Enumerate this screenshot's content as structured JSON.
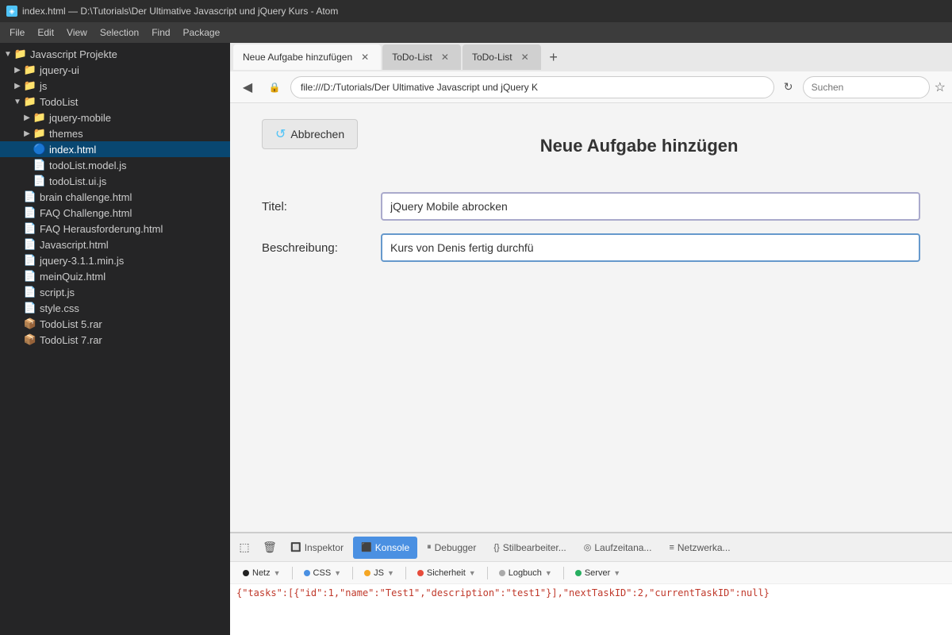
{
  "titlebar": {
    "icon": "◈",
    "text": "index.html — D:\\Tutorials\\Der Ultimative Javascript und jQuery Kurs - Atom"
  },
  "menubar": {
    "items": [
      "File",
      "Edit",
      "View",
      "Selection",
      "Find",
      "Package"
    ]
  },
  "sidebar": {
    "root_label": "Javascript Projekte",
    "items": [
      {
        "label": "jquery-ui",
        "type": "folder",
        "indent": 1,
        "open": false
      },
      {
        "label": "js",
        "type": "folder",
        "indent": 1,
        "open": false
      },
      {
        "label": "TodoList",
        "type": "folder",
        "indent": 1,
        "open": true
      },
      {
        "label": "jquery-mobile",
        "type": "folder",
        "indent": 2,
        "open": false
      },
      {
        "label": "themes",
        "type": "folder",
        "indent": 2,
        "open": false
      },
      {
        "label": "index.html",
        "type": "file",
        "indent": 2,
        "active": true
      },
      {
        "label": "todoList.model.js",
        "type": "file",
        "indent": 2
      },
      {
        "label": "todoList.ui.js",
        "type": "file",
        "indent": 2
      },
      {
        "label": "brain challenge.html",
        "type": "file",
        "indent": 1
      },
      {
        "label": "FAQ Challenge.html",
        "type": "file",
        "indent": 1
      },
      {
        "label": "FAQ Herausforderung.html",
        "type": "file",
        "indent": 1
      },
      {
        "label": "Javascript.html",
        "type": "file",
        "indent": 1
      },
      {
        "label": "jquery-3.1.1.min.js",
        "type": "file",
        "indent": 1
      },
      {
        "label": "meinQuiz.html",
        "type": "file",
        "indent": 1
      },
      {
        "label": "script.js",
        "type": "file",
        "indent": 1
      },
      {
        "label": "style.css",
        "type": "file",
        "indent": 1
      },
      {
        "label": "TodoList 5.rar",
        "type": "file",
        "indent": 1
      },
      {
        "label": "TodoList 7.rar",
        "type": "file",
        "indent": 1
      }
    ]
  },
  "browser": {
    "tabs": [
      {
        "label": "Neue Aufgabe hinzufügen",
        "active": true
      },
      {
        "label": "ToDo-List",
        "active": false
      },
      {
        "label": "ToDo-List",
        "active": false
      }
    ],
    "address": "file:///D:/Tutorials/Der Ultimative Javascript und jQuery K",
    "search_placeholder": "Suchen"
  },
  "page": {
    "back_button": "Abbrechen",
    "title": "Neue Aufgabe hinzügen",
    "form": {
      "title_label": "Titel:",
      "title_value": "jQuery Mobile abrocken",
      "desc_label": "Beschreibung:",
      "desc_value": "Kurs von Denis fertig durchfü"
    }
  },
  "devtools": {
    "tabs": [
      {
        "label": "Inspektor",
        "icon": "🔲",
        "active": false
      },
      {
        "label": "Konsole",
        "icon": "⬛",
        "active": true
      },
      {
        "label": "Debugger",
        "icon": "⏸",
        "active": false
      },
      {
        "label": "Stilbearbeiter...",
        "icon": "{}",
        "active": false
      },
      {
        "label": "Laufzeitana...",
        "icon": "◎",
        "active": false
      },
      {
        "label": "Netzwerka...",
        "icon": "≡",
        "active": false
      }
    ],
    "filters": [
      {
        "label": "Netz",
        "dot_color": "#222",
        "active": false
      },
      {
        "label": "CSS",
        "dot_color": "#4a90e2",
        "active": false
      },
      {
        "label": "JS",
        "dot_color": "#f5a623",
        "active": false
      },
      {
        "label": "Sicherheit",
        "dot_color": "#e74c3c",
        "active": false
      },
      {
        "label": "Logbuch",
        "dot_color": "#aaa",
        "active": false
      },
      {
        "label": "Server",
        "dot_color": "#27ae60",
        "active": false
      }
    ],
    "console_output": "{\"tasks\":[{\"id\":1,\"name\":\"Test1\",\"description\":\"test1\"}],\"nextTaskID\":2,\"currentTaskID\":null}"
  }
}
